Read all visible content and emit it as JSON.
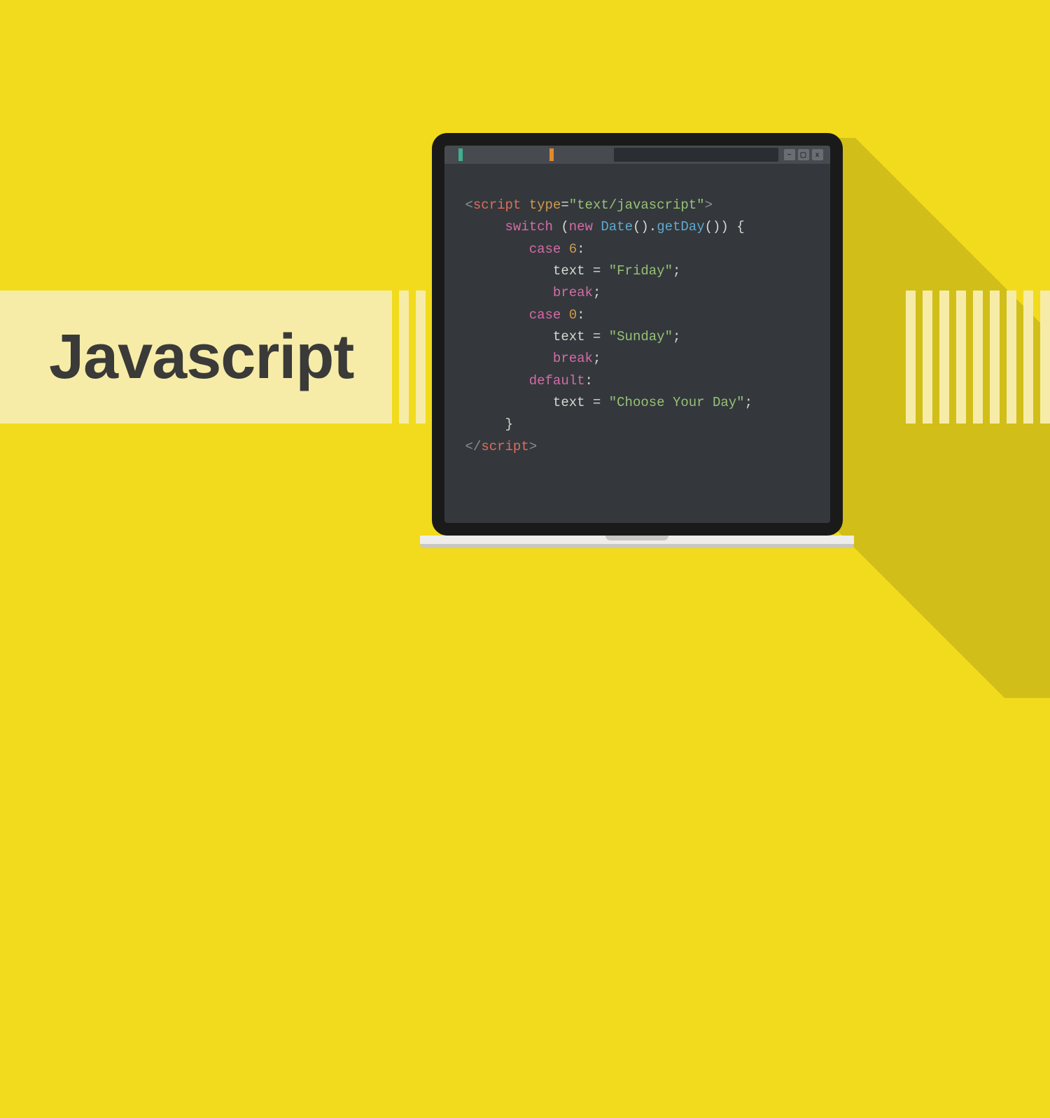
{
  "title": "Javascript",
  "window_controls": {
    "minimize": "−",
    "maximize": "▢",
    "close": "x"
  },
  "code": {
    "l1": {
      "open": "<",
      "tag": "script",
      "attr": " type",
      "eq": "=",
      "val": "\"text/javascript\"",
      "close": ">"
    },
    "l2": {
      "kw": "switch",
      "open": " (",
      "new": "new",
      "sp": " ",
      "cls": "Date",
      "call": "().",
      "m": "getDay",
      "end": "()) {"
    },
    "l3": {
      "kw": "case",
      "sp": " ",
      "n": "6",
      "colon": ":"
    },
    "l4": {
      "id": "text",
      "op": " = ",
      "str": "\"Friday\"",
      "semi": ";"
    },
    "l5": {
      "kw": "break",
      "semi": ";"
    },
    "l6": {
      "kw": "case",
      "sp": " ",
      "n": "0",
      "colon": ":"
    },
    "l7": {
      "id": "text",
      "op": " = ",
      "str": "\"Sunday\"",
      "semi": ";"
    },
    "l8": {
      "kw": "break",
      "semi": ";"
    },
    "l9": {
      "kw": "default",
      "colon": ":"
    },
    "l10": {
      "id": "text",
      "op": " = ",
      "str": "\"Choose Your Day\"",
      "semi": ";"
    },
    "l11": {
      "brace": "}"
    },
    "l12": {
      "open": "</",
      "tag": "script",
      "close": ">"
    }
  }
}
